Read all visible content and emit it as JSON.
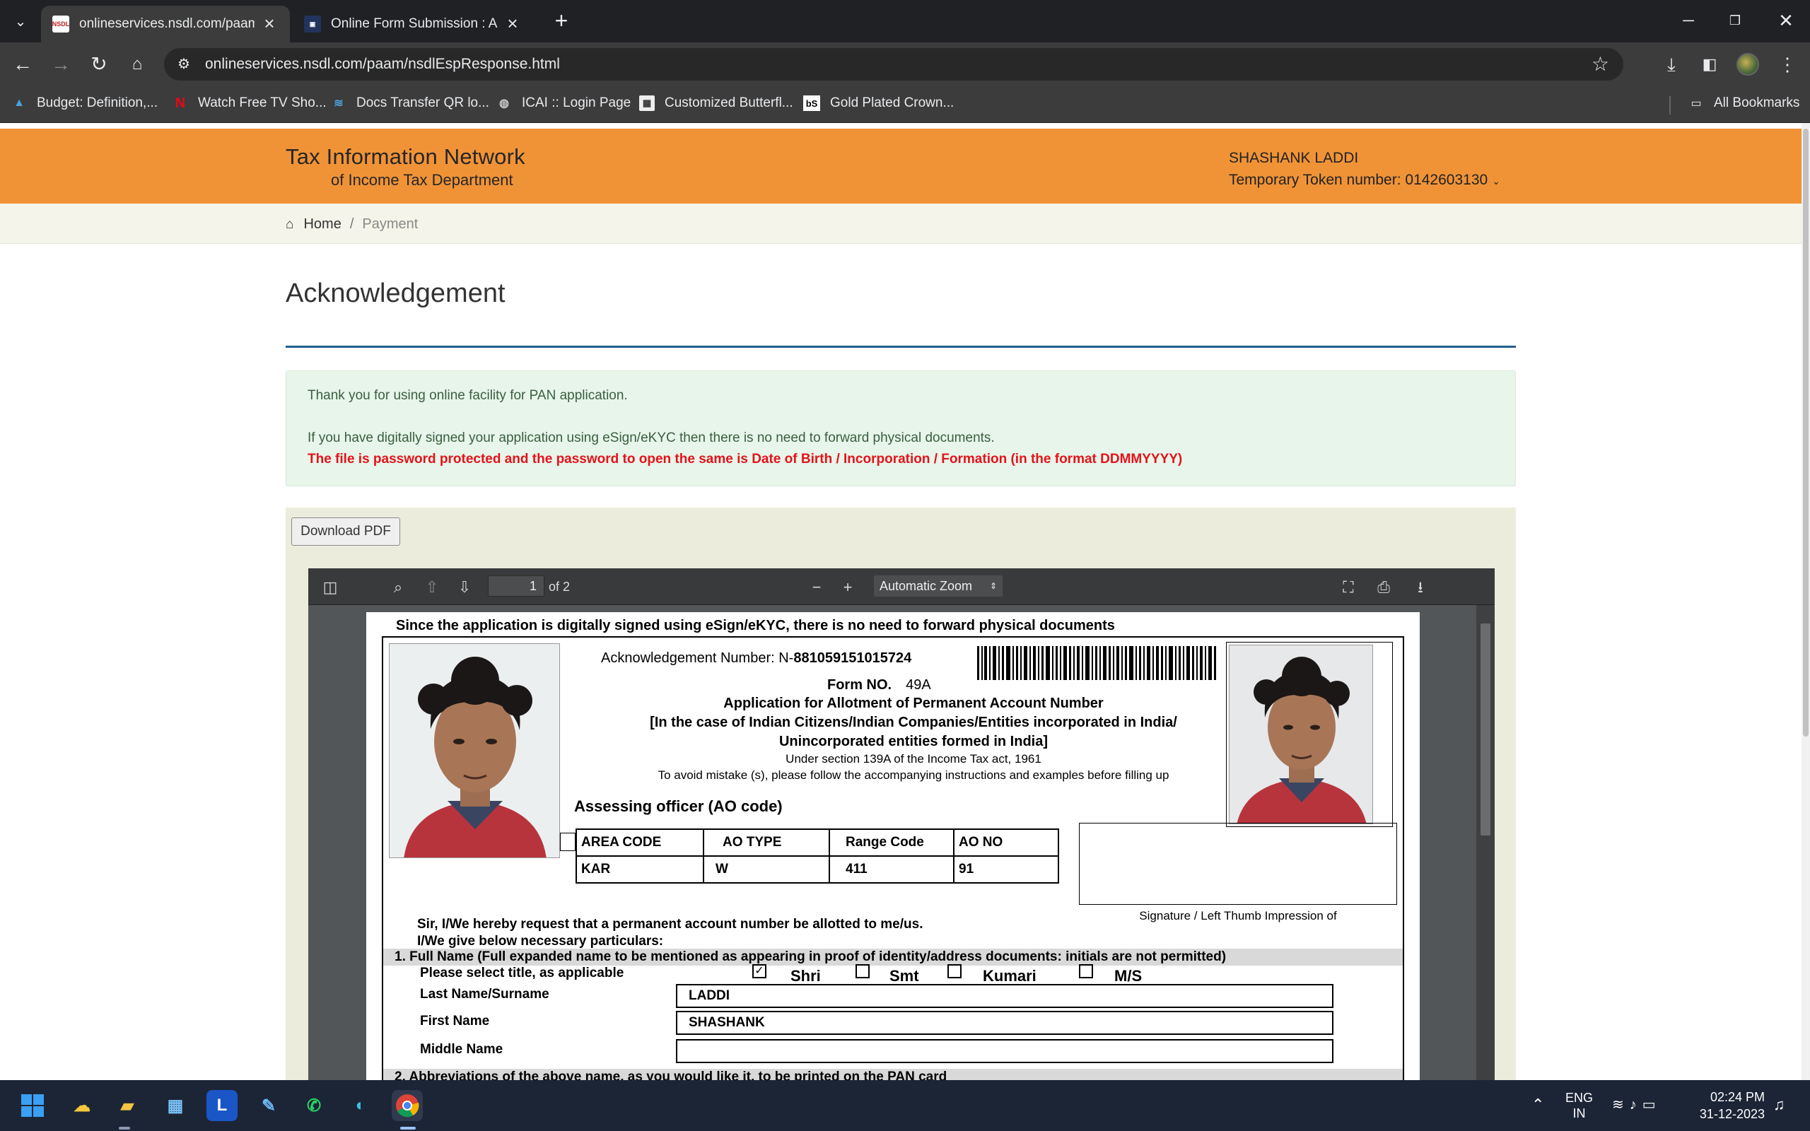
{
  "browser": {
    "tabs": [
      {
        "title": "onlineservices.nsdl.com/paam/nsdlEspResponse.html",
        "favicon": "NSDL",
        "active": true
      },
      {
        "title": "Online Form Submission : Apply",
        "favicon": "form-icon",
        "active": false
      }
    ],
    "url": "onlineservices.nsdl.com/paam/nsdlEspResponse.html",
    "bookmarks": [
      {
        "label": "Budget: Definition,...",
        "icon": "graduation-cap-icon"
      },
      {
        "label": "Watch Free TV Sho...",
        "icon": "netflix-icon"
      },
      {
        "label": "Docs Transfer QR lo...",
        "icon": "wifi-icon"
      },
      {
        "label": "ICAI :: Login Page",
        "icon": "globe-icon"
      },
      {
        "label": "Customized Butterfl...",
        "icon": "image-icon"
      },
      {
        "label": "Gold Plated Crown...",
        "icon": "bS"
      }
    ],
    "all_bookmarks": "All Bookmarks"
  },
  "header": {
    "logo_line1": "Tax Information Network",
    "logo_line2": "of Income Tax Department",
    "user_name": "SHASHANK LADDI",
    "token": "Temporary Token number: 0142603130"
  },
  "breadcrumb": {
    "home": "Home",
    "separator": "/",
    "current": "Payment"
  },
  "page_title": "Acknowledgement",
  "notice": {
    "line1": "Thank you for using online facility for PAN application.",
    "line2": "If you have digitally signed your application using eSign/eKYC then there is no need to forward physical documents.",
    "warning": "The file is password protected and the password to open the same is Date of Birth / Incorporation / Formation (in the format DDMMYYYY)"
  },
  "download_label": "Download PDF",
  "pdf_viewer": {
    "page_number": "1",
    "page_count": "of 2",
    "zoom": "Automatic Zoom"
  },
  "pdf": {
    "note_top": "Since the application is digitally signed using eSign/eKYC, there is no need to forward physical documents",
    "ack_label": "Acknowledgement Number: N-",
    "ack_number": "881059151015724",
    "form_no_label": "Form NO.",
    "form_no": "49A",
    "title_line1": "Application for Allotment of Permanent Account Number",
    "title_line2": "[In the case of Indian Citizens/Indian Companies/Entities incorporated in India/",
    "title_line3": "Unincorporated entities formed in India]",
    "sub_line1": "Under section 139A of the Income Tax act, 1961",
    "sub_line2": "To avoid mistake (s), please follow the accompanying instructions and examples before filling up",
    "ao_heading": "Assessing officer (AO code)",
    "ao_headers": [
      "AREA CODE",
      "AO TYPE",
      "Range Code",
      "AO NO"
    ],
    "ao_values": [
      "KAR",
      "W",
      "411",
      "91"
    ],
    "signature_caption": "Signature / Left Thumb Impression of",
    "request_line1": "Sir, I/We hereby request that a permanent account number be allotted to me/us.",
    "request_line2": "I/We give below necessary particulars:",
    "section1": "1.  Full Name (Full expanded name to be mentioned as appearing in proof of identity/address documents: initials are not permitted)",
    "title_prompt": "Please select title, as applicable",
    "titles": [
      "Shri",
      "Smt",
      "Kumari",
      "M/S"
    ],
    "selected_title": "Shri",
    "last_name_label": "Last  Name/Surname",
    "last_name": "LADDI",
    "first_name_label": "First Name",
    "first_name": "SHASHANK",
    "middle_name_label": "Middle Name",
    "middle_name": "",
    "section2": "2.  Abbreviations of the above name, as you would like it, to be printed on the PAN card"
  },
  "taskbar": {
    "language_line1": "ENG",
    "language_line2": "IN",
    "time": "02:24 PM",
    "date": "31-12-2023"
  }
}
